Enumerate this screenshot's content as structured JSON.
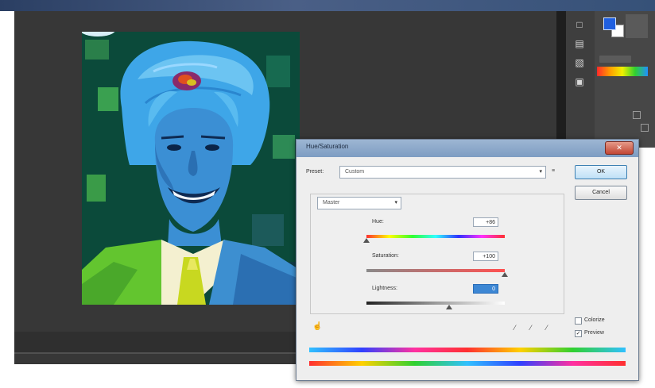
{
  "dialog": {
    "title": "Hue/Saturation",
    "close_icon": "close-icon",
    "preset_label": "Preset:",
    "preset_value": "Custom",
    "preset_options_icon": "menu-icon",
    "channel_value": "Master",
    "hue_label": "Hue:",
    "hue_value": "+86",
    "saturation_label": "Saturation:",
    "saturation_value": "+100",
    "lightness_label": "Lightness:",
    "lightness_value": "0",
    "hue_position": 0.0,
    "saturation_position": 1.0,
    "lightness_position": 0.6,
    "ok_label": "OK",
    "cancel_label": "Cancel",
    "colorize_label": "Colorize",
    "colorize_checked": false,
    "preview_label": "Preview",
    "preview_checked": true,
    "targeted_adjustment_icon": "hand-icon",
    "eyedroppers": [
      "eyedropper-icon",
      "eyedropper-plus-icon",
      "eyedropper-minus-icon"
    ]
  },
  "tools": [
    "history-icon",
    "actions-icon",
    "adjustments-icon",
    "layers-icon"
  ],
  "colors": {
    "workspace": "#373737",
    "dialog_bg": "#eeeeee",
    "titlebar": "#7d9cc2",
    "close": "#c24633",
    "selection": "#3d87d4"
  }
}
